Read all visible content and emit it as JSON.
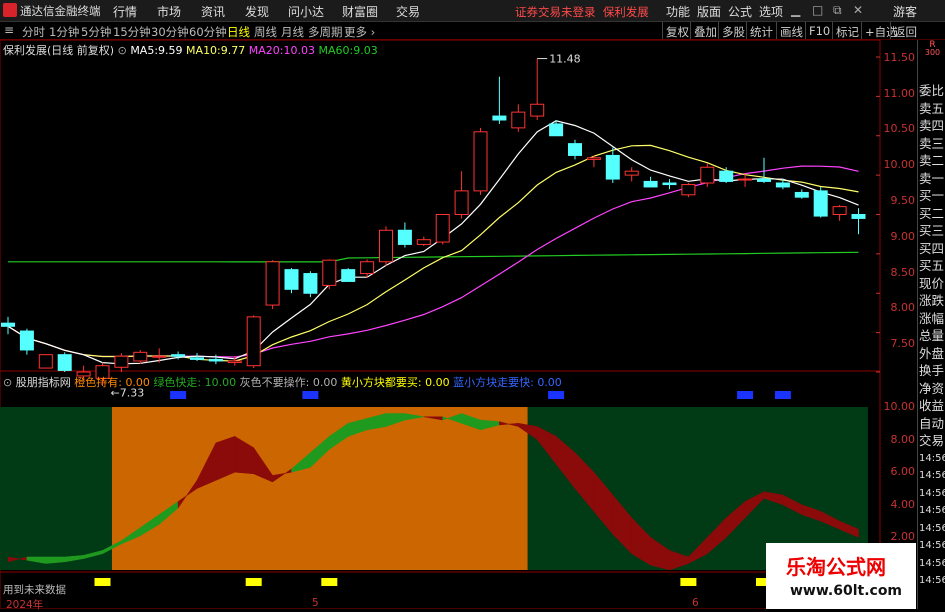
{
  "app": {
    "name": "通达信金融终端",
    "notice": "证券交易未登录",
    "stock": "保利发展",
    "user": "游客"
  },
  "menu_left": [
    "行情",
    "市场",
    "资讯",
    "发现",
    "问小达",
    "财富圈",
    "交易"
  ],
  "menu_right": [
    "功能",
    "版面",
    "公式",
    "选项"
  ],
  "periods": [
    "分时",
    "1分钟",
    "5分钟",
    "15分钟",
    "30分钟",
    "60分钟",
    "日线",
    "周线",
    "月线",
    "多周期",
    "更多"
  ],
  "active_period": "日线",
  "right_buttons": [
    "复权",
    "叠加",
    "多股",
    "统计",
    "画线",
    "F10",
    "标记",
    "+自选",
    "返回"
  ],
  "main_chart": {
    "title": "保利发展(日线 前复权)",
    "ma": [
      {
        "label": "MA5:",
        "value": "9.59",
        "color": "#ffffff"
      },
      {
        "label": "MA10:",
        "value": "9.77",
        "color": "#ffff66"
      },
      {
        "label": "MA20:",
        "value": "10.03",
        "color": "#ff44ff"
      },
      {
        "label": "MA60:",
        "value": "9.03",
        "color": "#22cc22"
      }
    ],
    "y_ticks": [
      "11.50",
      "11.00",
      "10.50",
      "10.00",
      "9.50",
      "9.00",
      "8.50",
      "8.00",
      "7.50"
    ],
    "high_label": "11.48",
    "low_label": "7.33",
    "candles": [
      [
        8.12,
        8.2,
        7.98,
        8.08
      ],
      [
        8.02,
        8.05,
        7.72,
        7.78
      ],
      [
        7.55,
        7.72,
        7.55,
        7.72
      ],
      [
        7.72,
        7.75,
        7.5,
        7.52
      ],
      [
        7.45,
        7.58,
        7.4,
        7.5
      ],
      [
        7.42,
        7.62,
        7.33,
        7.58
      ],
      [
        7.56,
        7.74,
        7.5,
        7.7
      ],
      [
        7.64,
        7.78,
        7.6,
        7.75
      ],
      [
        7.7,
        7.8,
        7.62,
        7.7
      ],
      [
        7.72,
        7.76,
        7.66,
        7.7
      ],
      [
        7.68,
        7.74,
        7.64,
        7.66
      ],
      [
        7.66,
        7.72,
        7.6,
        7.64
      ],
      [
        7.62,
        7.7,
        7.58,
        7.64
      ],
      [
        7.58,
        8.22,
        7.55,
        8.2
      ],
      [
        8.35,
        8.92,
        8.3,
        8.9
      ],
      [
        8.8,
        8.82,
        8.5,
        8.55
      ],
      [
        8.75,
        8.78,
        8.45,
        8.5
      ],
      [
        8.6,
        8.93,
        8.55,
        8.92
      ],
      [
        8.8,
        8.82,
        8.65,
        8.65
      ],
      [
        8.75,
        8.93,
        8.7,
        8.9
      ],
      [
        8.9,
        9.35,
        8.85,
        9.3
      ],
      [
        9.3,
        9.4,
        9.08,
        9.12
      ],
      [
        9.12,
        9.22,
        9.1,
        9.18
      ],
      [
        9.15,
        9.5,
        9.12,
        9.5
      ],
      [
        9.5,
        10.05,
        9.45,
        9.8
      ],
      [
        9.8,
        10.6,
        9.75,
        10.55
      ],
      [
        10.75,
        11.25,
        10.65,
        10.7
      ],
      [
        10.6,
        10.9,
        10.55,
        10.8
      ],
      [
        10.75,
        11.48,
        10.7,
        10.9
      ],
      [
        10.65,
        10.7,
        10.5,
        10.5
      ],
      [
        10.4,
        10.45,
        10.2,
        10.25
      ],
      [
        10.2,
        10.25,
        10.1,
        10.22
      ],
      [
        10.25,
        10.35,
        9.9,
        9.95
      ],
      [
        10.0,
        10.1,
        9.92,
        10.05
      ],
      [
        9.92,
        9.98,
        9.85,
        9.85
      ],
      [
        9.9,
        9.95,
        9.82,
        9.88
      ],
      [
        9.75,
        9.9,
        9.72,
        9.88
      ],
      [
        9.9,
        10.15,
        9.85,
        10.1
      ],
      [
        10.05,
        10.1,
        9.9,
        9.92
      ],
      [
        9.95,
        10.02,
        9.85,
        9.95
      ],
      [
        9.95,
        10.22,
        9.9,
        9.92
      ],
      [
        9.9,
        9.95,
        9.82,
        9.85
      ],
      [
        9.78,
        9.82,
        9.7,
        9.72
      ],
      [
        9.8,
        9.85,
        9.46,
        9.48
      ],
      [
        9.5,
        9.62,
        9.42,
        9.6
      ],
      [
        9.5,
        9.58,
        9.25,
        9.45
      ]
    ]
  },
  "indicator": {
    "title": "股朋指标网",
    "items": [
      {
        "label": "橙色持有:",
        "value": "0.00",
        "color": "#ff8800"
      },
      {
        "label": "绿色快走:",
        "value": "10.00",
        "color": "#22aa22"
      },
      {
        "label": "灰色不要操作:",
        "value": "0.00",
        "color": "#b0b0b0"
      },
      {
        "label": "黄小方块都要买:",
        "value": "0.00",
        "color": "#ffff00"
      },
      {
        "label": "蓝小方块走要快:",
        "value": "0.00",
        "color": "#3366ff"
      }
    ],
    "y_ticks": [
      "10.00",
      "8.00",
      "6.00",
      "4.00",
      "2.00"
    ],
    "hint": "用到未来数据",
    "band_a": [
      0.8,
      0.6,
      0.4,
      0.5,
      0.7,
      1.0,
      1.6,
      2.1,
      2.8,
      3.8,
      5.5,
      7.8,
      8.2,
      7.5,
      5.8,
      6.0,
      6.3,
      7.4,
      8.2,
      8.6,
      8.8,
      9.2,
      9.4,
      9.4,
      9.0,
      8.6,
      8.9,
      9.0,
      8.8,
      8.2,
      7.2,
      6.0,
      4.6,
      3.2,
      2.0,
      1.2,
      0.8,
      2.0,
      3.2,
      4.2,
      4.8,
      4.6,
      4.0,
      3.6,
      3.0,
      2.5
    ],
    "band_b": [
      0.5,
      0.8,
      0.8,
      0.8,
      0.9,
      1.2,
      1.8,
      2.6,
      3.4,
      4.2,
      5.0,
      5.5,
      6.0,
      5.9,
      5.4,
      6.2,
      7.2,
      8.2,
      9.0,
      9.3,
      9.6,
      9.6,
      9.4,
      9.2,
      9.6,
      9.2,
      9.1,
      8.8,
      8.0,
      6.5,
      5.0,
      3.6,
      2.2,
      1.0,
      0.3,
      0.0,
      0.4,
      1.0,
      2.0,
      3.2,
      4.4,
      4.0,
      3.4,
      3.0,
      2.5,
      2.0
    ],
    "zones": [
      {
        "start": 0,
        "end": 5,
        "color": "#013b15"
      },
      {
        "start": 6,
        "end": 27,
        "color": "#cc6600"
      },
      {
        "start": 28,
        "end": 45,
        "color": "#013b15"
      }
    ],
    "blue_marks": [
      9,
      16,
      29,
      39,
      41
    ],
    "yellow_marks": [
      5,
      13,
      17,
      36,
      40
    ]
  },
  "dates": [
    "2024年",
    "5",
    "6"
  ],
  "watermark": {
    "line1": "乐淘公式网",
    "line2": "www.60lt.com"
  },
  "sidebar": [
    "委比",
    "卖五",
    "卖四",
    "卖三",
    "卖二",
    "卖一",
    "买一",
    "买二",
    "买三",
    "买四",
    "买五",
    "现价",
    "涨跌",
    "涨幅",
    "总量",
    "外盘",
    "换手",
    "净资",
    "收益",
    "自动",
    "交易",
    "14:56",
    "14:56",
    "14:56",
    "14:56",
    "14:56",
    "14:56",
    "14:56",
    "14:56"
  ],
  "sidebar_top": "R",
  "sidebar_top2": "300",
  "colors": {
    "up": "#ff3333",
    "down": "#55ffff",
    "ma5": "#ffffff",
    "ma10": "#ffff66",
    "ma20": "#ff44ff",
    "ma60": "#22cc22",
    "grid": "#8b0000"
  }
}
